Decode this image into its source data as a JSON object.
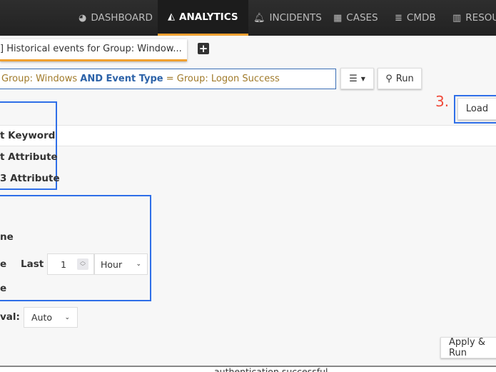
{
  "nav": {
    "items": [
      {
        "label": "DASHBOARD",
        "icon": "dashboard-icon"
      },
      {
        "label": "ANALYTICS",
        "icon": "area-chart-icon",
        "active": true
      },
      {
        "label": "INCIDENTS",
        "icon": "bell-icon"
      },
      {
        "label": "CASES",
        "icon": "archive-icon"
      },
      {
        "label": "CMDB",
        "icon": "database-icon"
      },
      {
        "label": "RESOU",
        "icon": "bar-chart-icon"
      }
    ],
    "accent": "#f0a030"
  },
  "tab": {
    "label": "] Historical events for Group: Window..."
  },
  "search": {
    "p1": "Group: Windows ",
    "p2": "AND Event Type",
    "p3": " = Group: Logon Success"
  },
  "run_label": "Run",
  "step_label": "3.",
  "load_label": "Load",
  "filter_options": [
    "t Keyword",
    "t Attribute",
    "3 Attribute"
  ],
  "time": {
    "opt1": "ne",
    "opt2": "e",
    "last_label": "Last",
    "last_value": "1",
    "unit": "Hour",
    "opt3": "e"
  },
  "interval": {
    "label": "val:",
    "value": "Auto"
  },
  "apply_label": "Apply & Run",
  "bottom_row": {
    "text": "authentication successful"
  },
  "highlight_color": "#2f6fe8"
}
